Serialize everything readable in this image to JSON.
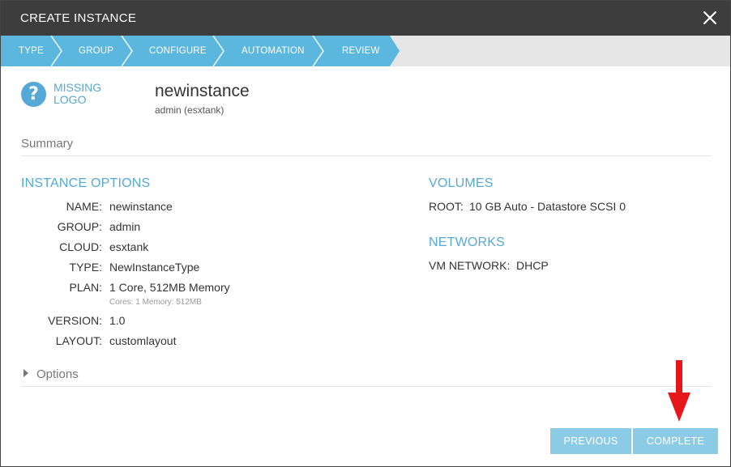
{
  "modal": {
    "title": "CREATE INSTANCE"
  },
  "steps": [
    {
      "label": "TYPE"
    },
    {
      "label": "GROUP"
    },
    {
      "label": "CONFIGURE"
    },
    {
      "label": "AUTOMATION"
    },
    {
      "label": "REVIEW"
    }
  ],
  "header_block": {
    "logo_text": "MISSING LOGO",
    "instance_name": "newinstance",
    "instance_sub": "admin (esxtank)"
  },
  "summary_label": "Summary",
  "instance_options": {
    "heading": "INSTANCE OPTIONS",
    "rows": [
      {
        "label": "NAME:",
        "value": "newinstance"
      },
      {
        "label": "GROUP:",
        "value": "admin"
      },
      {
        "label": "CLOUD:",
        "value": "esxtank"
      },
      {
        "label": "TYPE:",
        "value": "NewInstanceType"
      },
      {
        "label": "PLAN:",
        "value": "1 Core, 512MB Memory",
        "note": "Cores: 1 Memory: 512MB"
      },
      {
        "label": "VERSION:",
        "value": "1.0"
      },
      {
        "label": "LAYOUT:",
        "value": "customlayout"
      }
    ]
  },
  "volumes": {
    "heading": "VOLUMES",
    "label": "ROOT:",
    "value": "10 GB Auto - Datastore SCSI 0"
  },
  "networks": {
    "heading": "NETWORKS",
    "label": "VM NETWORK:",
    "value": "DHCP"
  },
  "options_toggle": "Options",
  "footer": {
    "previous_label": "PREVIOUS",
    "complete_label": "COMPLETE"
  },
  "colors": {
    "accent": "#56a8d6",
    "step_bar": "#5bb7de",
    "button": "#8ccbe6",
    "header_bg": "#3d3d3d",
    "annotation_arrow": "#e8161b"
  }
}
